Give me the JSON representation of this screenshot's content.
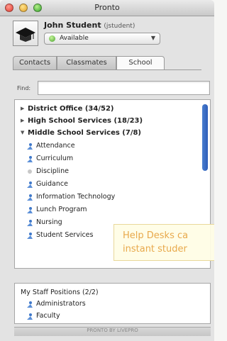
{
  "window": {
    "title": "Pronto"
  },
  "profile": {
    "name": "John Student",
    "handle": "(jstudent)",
    "status": "Available",
    "status_color": "#45a02a"
  },
  "tabs": [
    {
      "label": "Contacts",
      "selected": false
    },
    {
      "label": "Classmates",
      "selected": false
    },
    {
      "label": "School",
      "selected": true
    }
  ],
  "find": {
    "label": "Find:",
    "value": "",
    "placeholder": ""
  },
  "directory": {
    "groups": [
      {
        "label": "District Office (34/52)",
        "expanded": false
      },
      {
        "label": "High School Services (18/23)",
        "expanded": false
      },
      {
        "label": "Middle School Services (7/8)",
        "expanded": true
      }
    ],
    "items": [
      {
        "label": "Attendance",
        "available": true
      },
      {
        "label": "Curriculum",
        "available": true
      },
      {
        "label": "Discipline",
        "available": false
      },
      {
        "label": "Guidance",
        "available": true
      },
      {
        "label": "Information Technology",
        "available": true
      },
      {
        "label": "Lunch Program",
        "available": true
      },
      {
        "label": "Nursing",
        "available": true
      },
      {
        "label": "Student Services",
        "available": true
      }
    ]
  },
  "overlay": {
    "line1": "Help Desks ca",
    "line2": "instant studer",
    "text_color": "#e8a94b"
  },
  "staff": {
    "header": "My Staff Positions (2/2)",
    "items": [
      {
        "label": "Administrators"
      },
      {
        "label": "Faculty"
      }
    ]
  },
  "footer": {
    "text": "PRONTO BY LIVEPRO"
  }
}
